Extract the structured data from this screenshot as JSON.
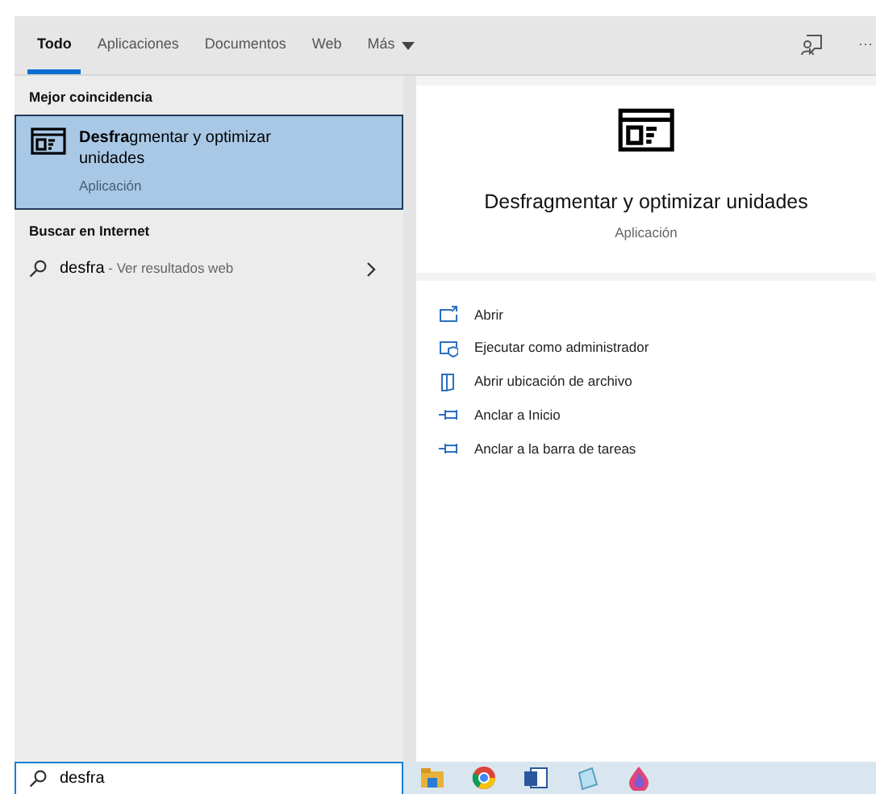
{
  "tabs": [
    {
      "label": "Todo",
      "selected": true
    },
    {
      "label": "Aplicaciones",
      "selected": false
    },
    {
      "label": "Documentos",
      "selected": false
    },
    {
      "label": "Web",
      "selected": false
    },
    {
      "label": "Más",
      "selected": false,
      "kind": "dropdown"
    }
  ],
  "toolbar": [
    {
      "kind": "feedback"
    },
    {
      "label": "···",
      "kind": "more"
    }
  ],
  "best_match": {
    "heading": "Mejor coincidencia",
    "title": "**Desfra**gmentar y optimizar unidades",
    "subtitle": "Aplicación",
    "selected": true
  },
  "web_search": {
    "heading": "Buscar en Internet",
    "query": "desfra",
    "suffix": " - Ver resultados web"
  },
  "detail": {
    "title": "Desfragmentar y optimizar unidades",
    "subtitle": "Aplicación",
    "actions": [
      {
        "label": "Abrir",
        "kind": "open"
      },
      {
        "label": "Ejecutar como administrador",
        "kind": "admin"
      },
      {
        "label": "Abrir ubicación de archivo",
        "kind": "folder"
      },
      {
        "label": "Anclar a Inicio",
        "kind": "pin"
      },
      {
        "label": "Anclar a la barra de tareas",
        "kind": "pin"
      }
    ]
  },
  "search_box": {
    "value": "desfra"
  },
  "taskbar": [
    {
      "kind": "files"
    },
    {
      "kind": "browser"
    },
    {
      "kind": "word"
    },
    {
      "kind": "notepad"
    },
    {
      "kind": "paint"
    }
  ]
}
